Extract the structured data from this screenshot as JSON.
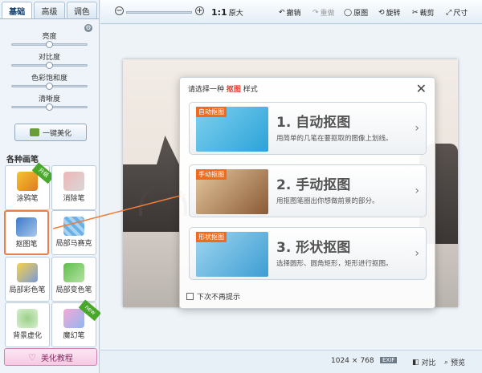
{
  "sidebar": {
    "tabs": [
      "基础",
      "高级",
      "调色"
    ],
    "adjustments": [
      "亮度",
      "对比度",
      "色彩饱和度",
      "清晰度"
    ],
    "adjust_values": [
      0.5,
      0.5,
      0.5,
      0.5
    ],
    "one_key": "一键美化",
    "brushes_title": "各种画笔",
    "brushes": [
      {
        "label": "涂鸦笔",
        "badge": "升级"
      },
      {
        "label": "消除笔"
      },
      {
        "label": "抠图笔"
      },
      {
        "label": "局部马赛克"
      },
      {
        "label": "局部彩色笔"
      },
      {
        "label": "局部变色笔"
      },
      {
        "label": "背景虚化"
      },
      {
        "label": "魔幻笔",
        "badge": "new"
      }
    ],
    "tutorial": "美化教程"
  },
  "toolbar": {
    "zoom_one": "1:1",
    "original_size": "原大",
    "undo": "撤销",
    "redo": "重做",
    "original": "原图",
    "rotate": "旋转",
    "crop": "裁剪",
    "size": "尺寸"
  },
  "dialog": {
    "title_prefix": "请选择一种",
    "title_highlight": "抠图",
    "title_suffix": "样式",
    "options": [
      {
        "tag": "自动抠图",
        "title": "1. 自动抠图",
        "desc": "用简单的几笔在要抠取的图像上划线。"
      },
      {
        "tag": "手动抠图",
        "title": "2. 手动抠图",
        "desc": "用抠图笔圈出你想做前景的部分。"
      },
      {
        "tag": "形状抠图",
        "title": "3. 形状抠图",
        "desc": "选择圆形、圆角矩形，矩形进行抠图。"
      }
    ],
    "dont_show": "下次不再提示"
  },
  "status": {
    "width": "1024",
    "times": "×",
    "height": "768",
    "exif": "EXIF",
    "compare": "对比",
    "preview": "预览"
  },
  "colors": {
    "accent_orange": "#f26b1d",
    "highlight_red": "#e23a2a",
    "tab_text": "#0a3a6a"
  }
}
